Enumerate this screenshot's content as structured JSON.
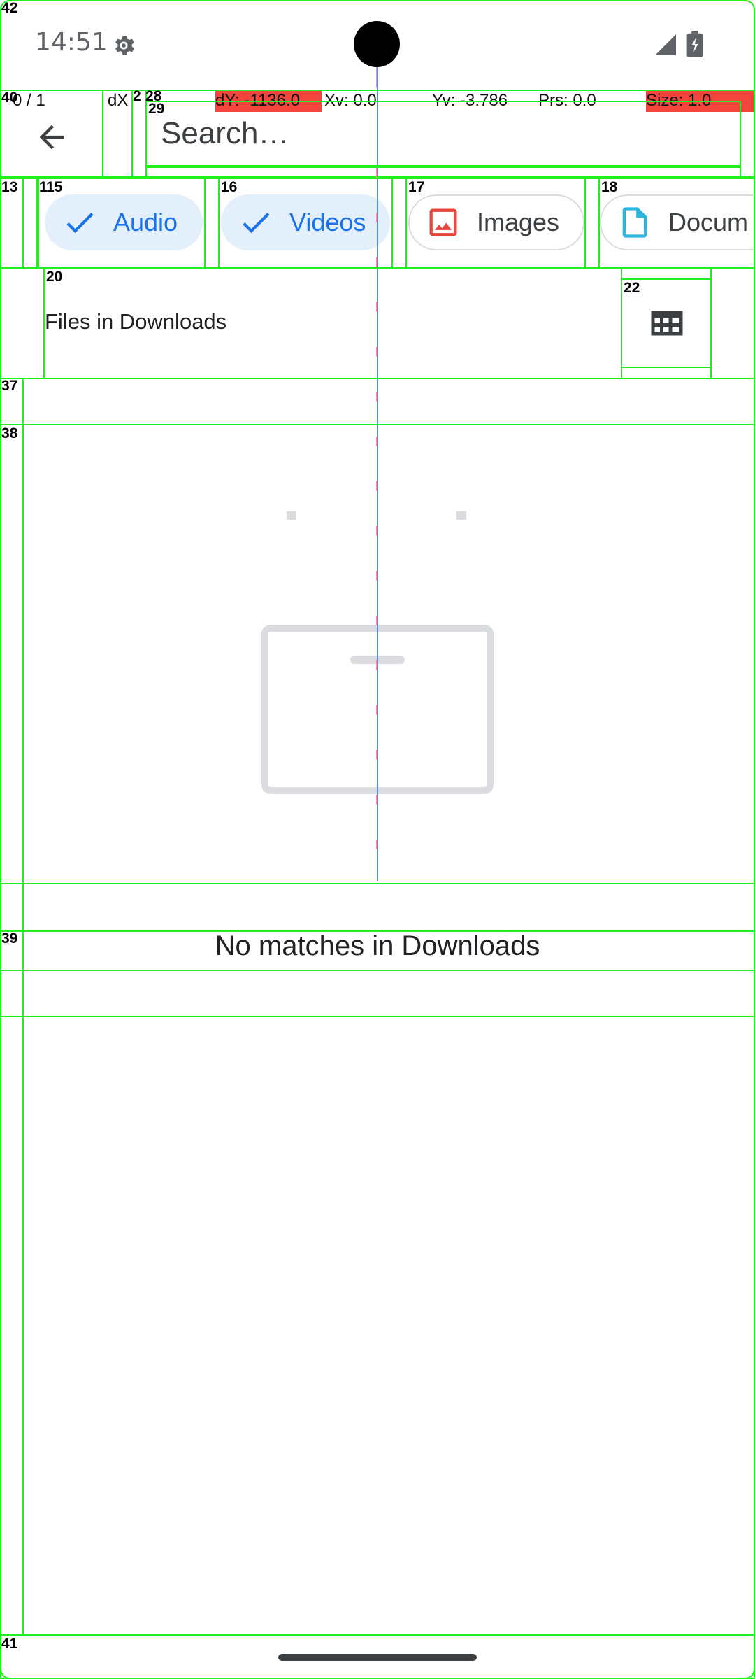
{
  "status_bar": {
    "time": "14:51",
    "icons": [
      "settings-icon",
      "signal-icon",
      "battery-charging-icon"
    ]
  },
  "pointer_overlay": {
    "pointers": "0 / 1",
    "dx": "dX",
    "dy": "dY: -1136.0",
    "xv": "Xv: 0.0",
    "yv": "Yv: -3.786",
    "prs": "Prs: 0.0",
    "size": "Size: 1.0",
    "highlight_color": "#f2453e"
  },
  "toolbar": {
    "back_icon": "arrow-back-icon",
    "search_placeholder": "Search…"
  },
  "chips": [
    {
      "label": "Audio",
      "selected": true,
      "icon": "check-icon"
    },
    {
      "label": "Videos",
      "selected": true,
      "icon": "check-icon"
    },
    {
      "label": "Images",
      "selected": false,
      "icon": "image-icon"
    },
    {
      "label": "Docum",
      "selected": false,
      "icon": "document-icon"
    }
  ],
  "header": {
    "title": "Files in Downloads",
    "view_toggle_icon": "grid-view-icon"
  },
  "empty_state": {
    "illustration": "empty-tray-icon",
    "message": "No matches in Downloads"
  },
  "overlay_labels": {
    "n42": "42",
    "n40": "40",
    "n2": "2",
    "n28": "28",
    "n29": "29",
    "n13": "13",
    "n1": "1",
    "n15": "15",
    "n16": "16",
    "n17": "17",
    "n18": "18",
    "n20": "20",
    "n22": "22",
    "n37": "37",
    "n38": "38",
    "n39": "39",
    "n41": "41"
  },
  "colors": {
    "accent": "#1a73e8",
    "chip_selected_bg": "#e3f0fb",
    "overlay_box": "#22ee22",
    "image_icon": "#e8453c",
    "document_icon": "#2cb5e0"
  }
}
